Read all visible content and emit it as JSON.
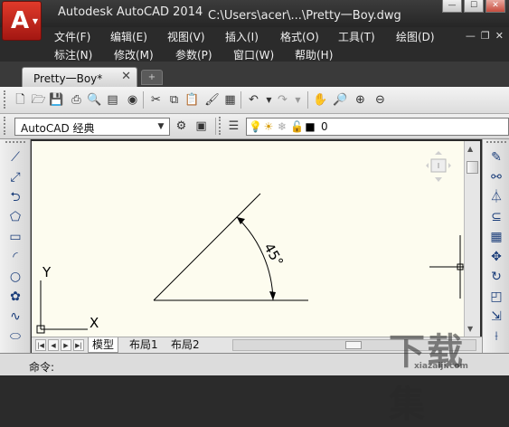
{
  "titlebar": {
    "app_name": "Autodesk AutoCAD 2014",
    "file_path": "C:\\Users\\acer\\...\\Pretty一Boy.dwg",
    "app_logo": "A",
    "controls": [
      "—",
      "☐",
      "✕"
    ]
  },
  "menu": {
    "row1": [
      "文件(F)",
      "编辑(E)",
      "视图(V)",
      "插入(I)",
      "格式(O)",
      "工具(T)",
      "绘图(D)"
    ],
    "row2": [
      "标注(N)",
      "修改(M)",
      "参数(P)",
      "窗口(W)",
      "帮助(H)"
    ],
    "mdi_controls": [
      "—",
      "❐",
      "✕"
    ]
  },
  "tabs": {
    "document_tab": "Pretty一Boy*",
    "close_glyph": "✕",
    "new_tab_glyph": "+"
  },
  "toolbar": {
    "workspace": "AutoCAD 经典",
    "layer_name": "0",
    "dropdown_glyph": "▼",
    "icons": [
      "new-icon",
      "open-icon",
      "save-icon",
      "print-icon",
      "preview-icon",
      "publish-icon",
      "plot-icon",
      "cut-icon",
      "copy-icon",
      "paste-icon",
      "match-properties-icon",
      "block-editor-icon",
      "undo-icon",
      "redo-icon",
      "pan-icon",
      "zoom-realtime-icon",
      "zoom-window-icon",
      "zoom-previous-icon"
    ]
  },
  "drawing": {
    "dimension_text": "45°",
    "ucs_x_label": "X",
    "ucs_y_label": "Y",
    "background": "#fdfcef",
    "crosshair_color": "#000000"
  },
  "layout_tabs": [
    "模型",
    "布局1",
    "布局2"
  ],
  "command": {
    "text": "命令: "
  },
  "watermark": {
    "big": "下载集",
    "small": "xiazaiji.com"
  }
}
